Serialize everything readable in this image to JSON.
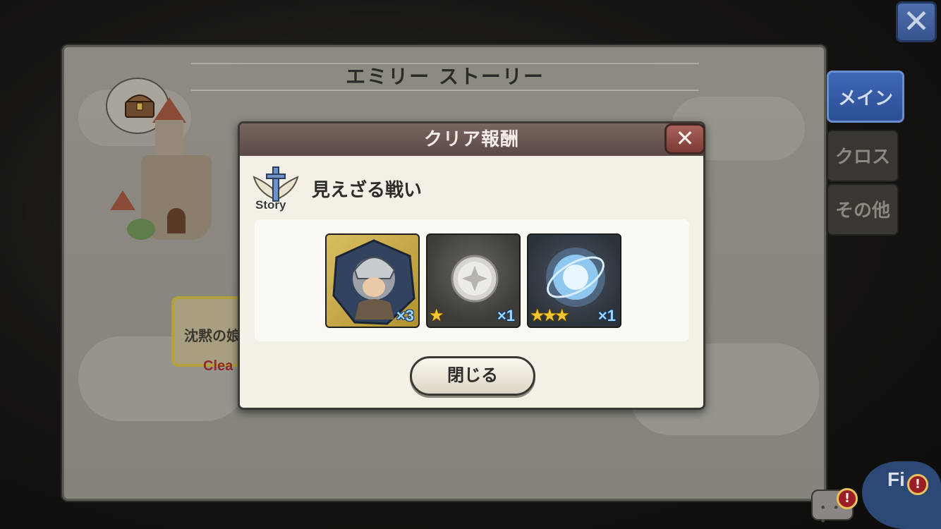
{
  "story_panel": {
    "title": "エミリー ストーリー",
    "stage_label": "沈黙の娘",
    "stage_status": "Clea"
  },
  "side_tabs": [
    {
      "label": "メイン",
      "active": true
    },
    {
      "label": "クロス",
      "active": false
    },
    {
      "label": "その他",
      "active": false
    }
  ],
  "top_close": {
    "icon": "close-icon",
    "glyph": "✕"
  },
  "hud": {
    "field_label": "Fi",
    "alert_glyph": "!",
    "chat_dots": "• • •"
  },
  "dialog": {
    "title": "クリア報酬",
    "close_glyph": "✕",
    "badge_text": "Story",
    "quest_title": "見えざる戦い",
    "rewards": [
      {
        "name": "character-ticket",
        "quantity": "×3",
        "stars": ""
      },
      {
        "name": "silver-orb",
        "quantity": "×1",
        "stars": "★"
      },
      {
        "name": "light-crystal",
        "quantity": "×1",
        "stars": "★★★"
      }
    ],
    "close_button": "閉じる"
  },
  "colors": {
    "dialog_header": "#5a4945",
    "dialog_body": "#f3f1e6",
    "active_tab": "#2c4f93",
    "quantity_text": "#9bd7ff",
    "star": "#f2c531"
  }
}
